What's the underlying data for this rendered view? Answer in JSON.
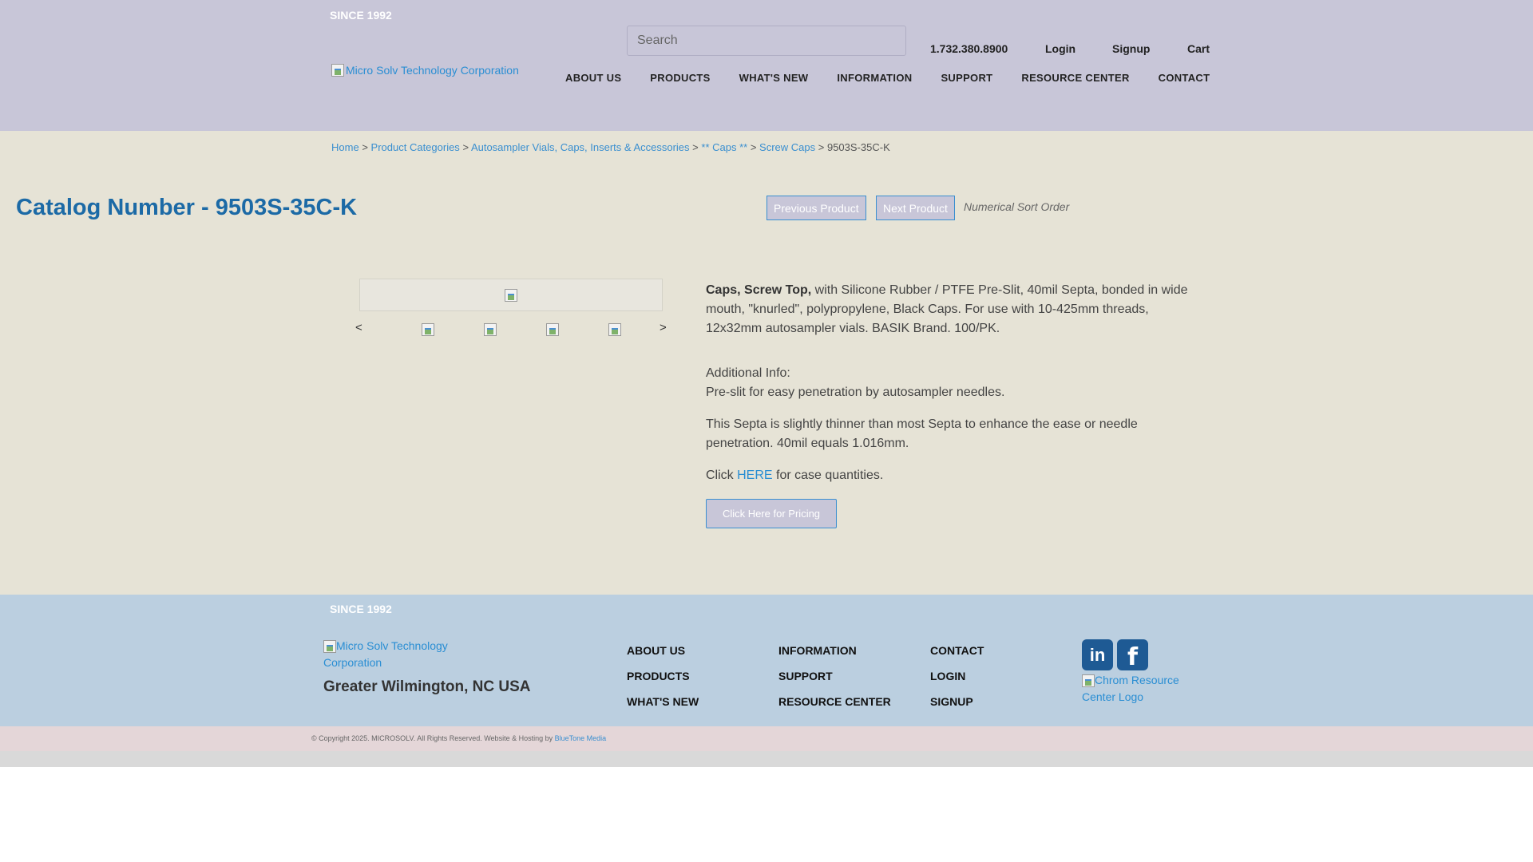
{
  "header": {
    "since": "SINCE 1992",
    "logo_alt": "Micro Solv Technology Corporation",
    "search_placeholder": "Search",
    "phone": "1.732.380.8900",
    "login": "Login",
    "signup": "Signup",
    "cart": "Cart",
    "nav": [
      "ABOUT US",
      "PRODUCTS",
      "WHAT'S NEW",
      "INFORMATION",
      "SUPPORT",
      "RESOURCE CENTER",
      "CONTACT"
    ]
  },
  "breadcrumb": {
    "items": [
      "Home",
      "Product Categories",
      "Autosampler Vials, Caps, Inserts & Accessories",
      "** Caps **",
      "Screw Caps"
    ],
    "separator": ">",
    "current": "9503S-35C-K"
  },
  "product": {
    "title": "Catalog Number - 9503S-35C-K",
    "prev_label": "Previous Product",
    "next_label": "Next Product",
    "sort_note": "Numerical Sort Order",
    "gallery": {
      "prev_arrow": "<",
      "next_arrow": ">"
    },
    "desc_bold": "Caps, Screw Top,",
    "desc_rest": " with Silicone Rubber / PTFE Pre-Slit, 40mil Septa, bonded in wide mouth, \"knurled\", polypropylene, Black Caps. For use with 10-425mm threads, 12x32mm autosampler vials. BASIK Brand. 100/PK.",
    "additional_heading": "Additional Info:",
    "additional_text": "Pre-slit for easy penetration by autosampler needles.",
    "septa_note": "This Septa is slightly thinner than most Septa to enhance the ease or needle penetration. 40mil equals 1.016mm.",
    "click_prefix": "Click ",
    "click_link": "HERE",
    "click_suffix": " for case quantities.",
    "pricing_label": "Click Here for Pricing"
  },
  "footer": {
    "since": "SINCE 1992",
    "logo_alt": "Micro Solv Technology Corporation",
    "location": "Greater Wilmington, NC USA",
    "columns": [
      [
        "ABOUT US",
        "PRODUCTS",
        "WHAT'S NEW"
      ],
      [
        "INFORMATION",
        "SUPPORT",
        "RESOURCE CENTER"
      ],
      [
        "CONTACT",
        "LOGIN",
        "SIGNUP"
      ]
    ],
    "linkedin_glyph": "in",
    "facebook_glyph": "f",
    "chrom_alt": "Chrom Resource Center Logo",
    "copyright": "© Copyright 2025. MICROSOLV. All Rights Reserved. Website & Hosting by ",
    "credit_link": "BlueTone Media"
  },
  "colors": {
    "header_bg": "#c8c6d8",
    "band_bg": "#e6e3d6",
    "footer_bg": "#bbcfe0",
    "title_blue": "#1c6aa6",
    "link_blue": "#2a8ed3"
  }
}
